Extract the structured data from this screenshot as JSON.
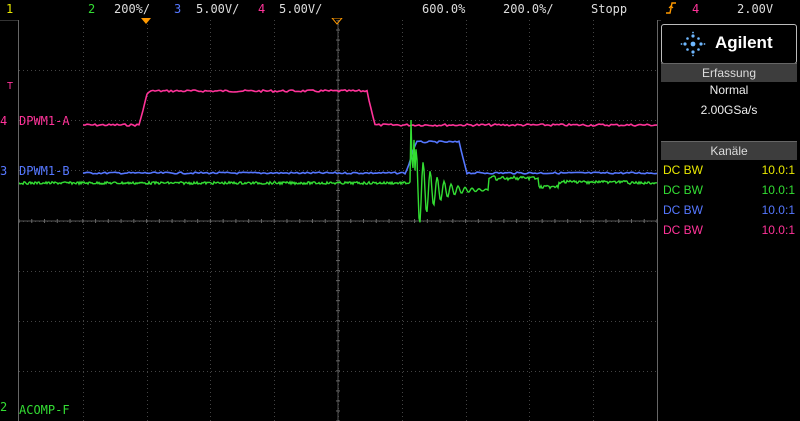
{
  "colors": {
    "ch1": "#e8e800",
    "ch2": "#33dd33",
    "ch3": "#5577ff",
    "ch4": "#ff3399",
    "trigger": "#ff9900"
  },
  "topbar": {
    "ch1_num": "1",
    "ch2_num": "2",
    "ch2_scale": "200%/",
    "ch3_num": "3",
    "ch3_scale": "5.00V/",
    "ch4_num": "4",
    "ch4_scale": "5.00V/",
    "timebase": "600.0%",
    "delay": "200.0%/",
    "run_state": "Stopp",
    "trigger_icon": "trigger-edge-icon",
    "trigger_source": "4",
    "trigger_level": "2.00V"
  },
  "sidebar": {
    "brand": "Agilent",
    "acq_title": "Erfassung",
    "acq_mode": "Normal",
    "acq_rate": "2.00GSa/s",
    "channels_title": "Kanäle",
    "channels": [
      {
        "coupling": "DC BW",
        "probe": "10.0:1",
        "color": "#e8e800"
      },
      {
        "coupling": "DC BW",
        "probe": "10.0:1",
        "color": "#33dd33"
      },
      {
        "coupling": "DC BW",
        "probe": "10.0:1",
        "color": "#5577ff"
      },
      {
        "coupling": "DC BW",
        "probe": "10.0:1",
        "color": "#ff3399"
      }
    ]
  },
  "traces": {
    "ch4_label": "DPWM1-A",
    "ch3_label": "DPWM1-B",
    "ch2_label": "ACOMP-F",
    "ch4_marker": "4",
    "ch3_marker": "3",
    "ch2_marker": "2",
    "trigger_marker": "T"
  }
}
